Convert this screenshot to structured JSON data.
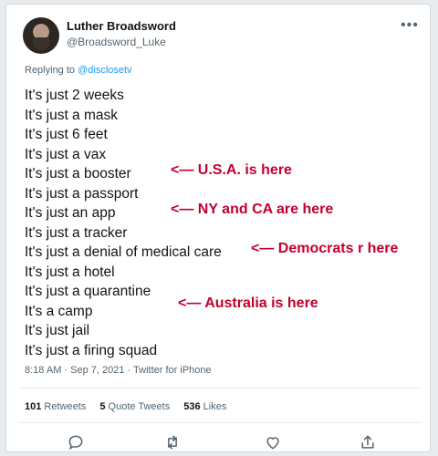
{
  "tweet": {
    "author_name": "Luther Broadsword",
    "author_handle": "@Broadsword_Luke",
    "more_label": "•••",
    "replying_prefix": "Replying to ",
    "replying_mention": "@disclosetv",
    "lines": [
      "It's just 2 weeks",
      "It's just a mask",
      "It's just 6 feet",
      "It's just a vax",
      "It's just a booster",
      "It's just a passport",
      "It's just an app",
      "It's just a tracker",
      "It's just a denial of medical care",
      "It's just a hotel",
      "It's just a quarantine",
      "It's a camp",
      "It's just jail",
      "It's just a firing squad"
    ],
    "annotations": {
      "usa": "<— U.S.A. is here",
      "ny_ca": "<— NY and CA are here",
      "democrats": "<— Democrats r here",
      "australia": "<— Australia is here"
    },
    "timestamp": "8:18 AM · Sep 7, 2021 · Twitter for iPhone",
    "stats": {
      "retweets_count": "101",
      "retweets_label": " Retweets",
      "quotes_count": "5",
      "quotes_label": " Quote Tweets",
      "likes_count": "536",
      "likes_label": " Likes"
    }
  },
  "colors": {
    "annotation": "#c3002f",
    "mention": "#1d9bf0",
    "secondary_text": "#536471"
  },
  "icons": [
    "reply-icon",
    "retweet-icon",
    "like-icon",
    "share-icon"
  ]
}
